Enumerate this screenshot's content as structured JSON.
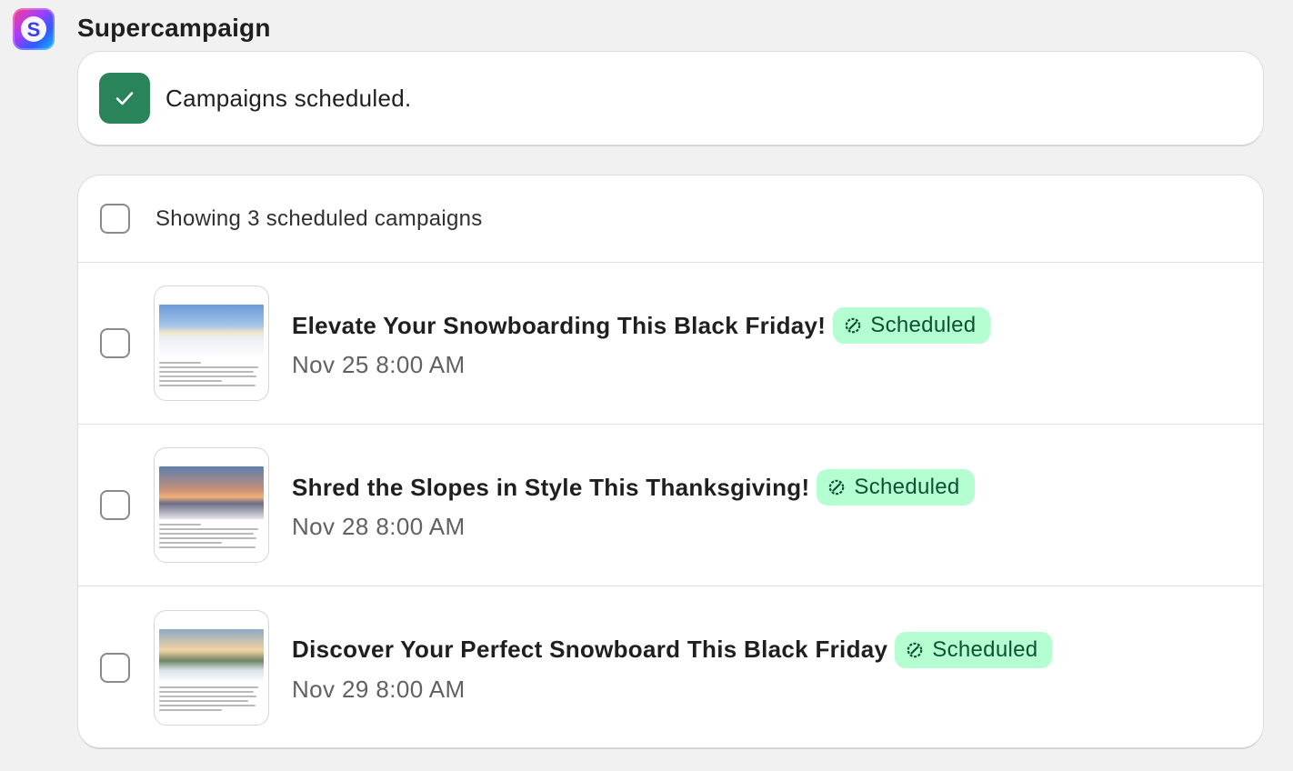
{
  "app": {
    "title": "Supercampaign",
    "logo_letter": "S",
    "logo_icon": "supercampaign-logo-icon"
  },
  "banner": {
    "icon": "checkmark-icon",
    "text": "Campaigns scheduled.",
    "color": "#29845a"
  },
  "list": {
    "header_text": "Showing 3 scheduled campaigns",
    "items": [
      {
        "title": "Elevate Your Snowboarding This Black Friday!",
        "status": "Scheduled",
        "date": "Nov 25 8:00 AM"
      },
      {
        "title": "Shred the Slopes in Style This Thanksgiving!",
        "status": "Scheduled",
        "date": "Nov 28 8:00 AM"
      },
      {
        "title": "Discover Your Perfect Snowboard This Black Friday",
        "status": "Scheduled",
        "date": "Nov 29 8:00 AM"
      }
    ]
  },
  "colors": {
    "badge_bg": "#b4fed2",
    "badge_text": "#0c5132",
    "page_bg": "#f1f1f1"
  }
}
